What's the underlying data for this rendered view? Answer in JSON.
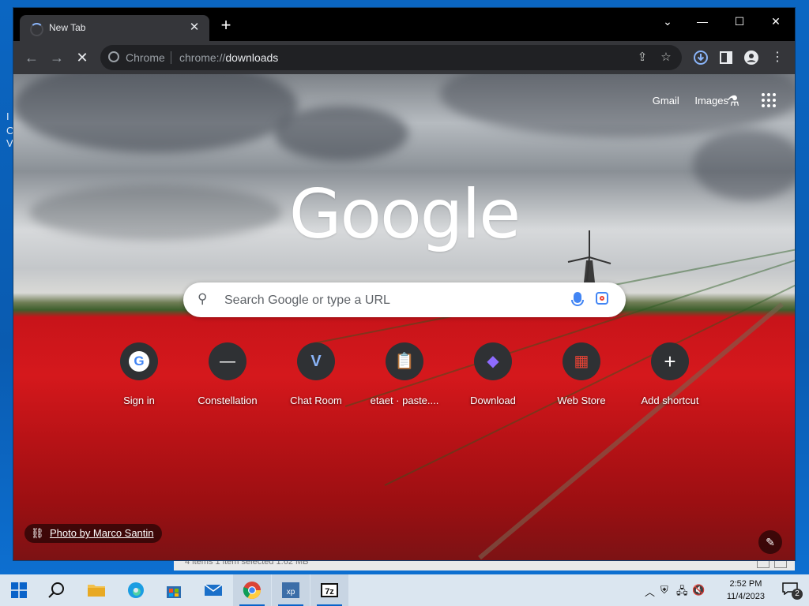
{
  "browser": {
    "tab_title": "New Tab",
    "omnibox_chip": "Chrome",
    "url_scheme": "chrome://",
    "url_host": "downloads"
  },
  "ntp": {
    "links": [
      "Gmail",
      "Images"
    ],
    "logo": "Google",
    "search_placeholder": "Search Google or type a URL",
    "shortcuts": [
      {
        "label": "Sign in",
        "icon": "G"
      },
      {
        "label": "Constellation",
        "icon": "—"
      },
      {
        "label": "Chat Room",
        "icon": "V"
      },
      {
        "label": "etaet · paste....",
        "icon": "📋"
      },
      {
        "label": "Download",
        "icon": "◆"
      },
      {
        "label": "Web Store",
        "icon": "▦"
      },
      {
        "label": "Add shortcut",
        "icon": "+"
      }
    ],
    "photo_credit": "Photo by Marco Santin"
  },
  "taskbar": {
    "time": "2:52 PM",
    "date": "11/4/2023",
    "notification_count": "2"
  },
  "colors": {
    "accent_blue": "#4285f4",
    "tulip_red": "#d5181c",
    "chrome_dark": "#35363a"
  }
}
